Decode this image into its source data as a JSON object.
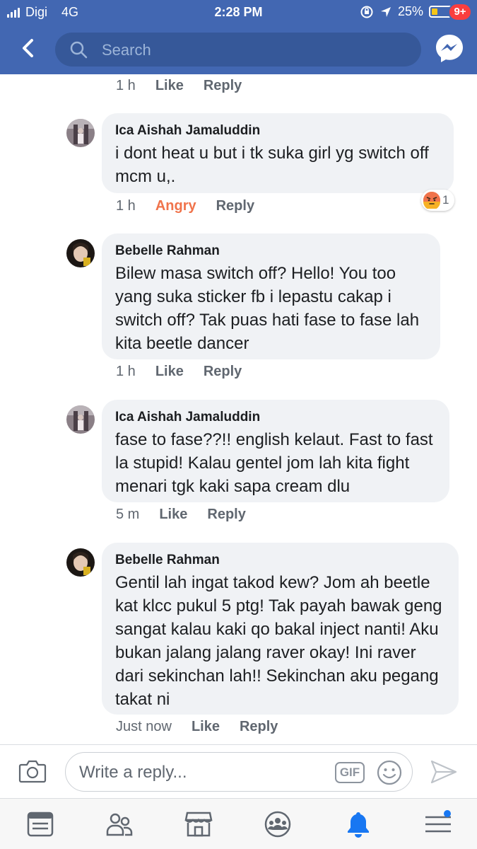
{
  "status_bar": {
    "carrier": "Digi",
    "network": "4G",
    "time": "2:28 PM",
    "battery": "25%",
    "battery_fill_fraction": 0.25
  },
  "header": {
    "search_placeholder": "Search",
    "messenger_badge": "9+"
  },
  "first_meta": {
    "time": "1 h",
    "like": "Like",
    "reply": "Reply"
  },
  "comments": [
    {
      "author": "Ica Aishah Jamaluddin",
      "text": "i dont heat u but i tk suka girl yg switch off mcm u,.",
      "time": "1 h",
      "reaction_label": "Angry",
      "reply": "Reply",
      "reaction_count": "1"
    },
    {
      "author": "Bebelle Rahman",
      "text": "Bilew masa switch off? Hello! You too yang suka sticker fb i lepastu cakap i switch off? Tak puas hati fase to fase lah kita beetle dancer",
      "time": "1 h",
      "like": "Like",
      "reply": "Reply"
    },
    {
      "author": "Ica Aishah Jamaluddin",
      "text": "fase to fase??!! english kelaut. Fast to fast la stupid! Kalau gentel jom lah kita fight menari tgk kaki sapa cream dlu",
      "time": "5 m",
      "like": "Like",
      "reply": "Reply"
    },
    {
      "author": "Bebelle Rahman",
      "text": "Gentil lah ingat takod kew? Jom ah beetle kat klcc pukul 5 ptg! Tak payah bawak geng sangat kalau kaki qo bakal inject nanti! Aku bukan jalang jalang raver okay! Ini raver dari sekinchan lah!! Sekinchan aku pegang takat ni",
      "time": "Just now",
      "like": "Like",
      "reply": "Reply"
    }
  ],
  "composer": {
    "placeholder": "Write a reply...",
    "gif_label": "GIF"
  },
  "colors": {
    "brand_blue": "#4267b2",
    "search_bg": "#365899",
    "bubble_bg": "#f0f2f5",
    "angry": "#f0734b",
    "notification_blue": "#1877f2"
  },
  "tabs": [
    "news-feed",
    "friends",
    "marketplace",
    "groups",
    "notifications",
    "menu"
  ]
}
